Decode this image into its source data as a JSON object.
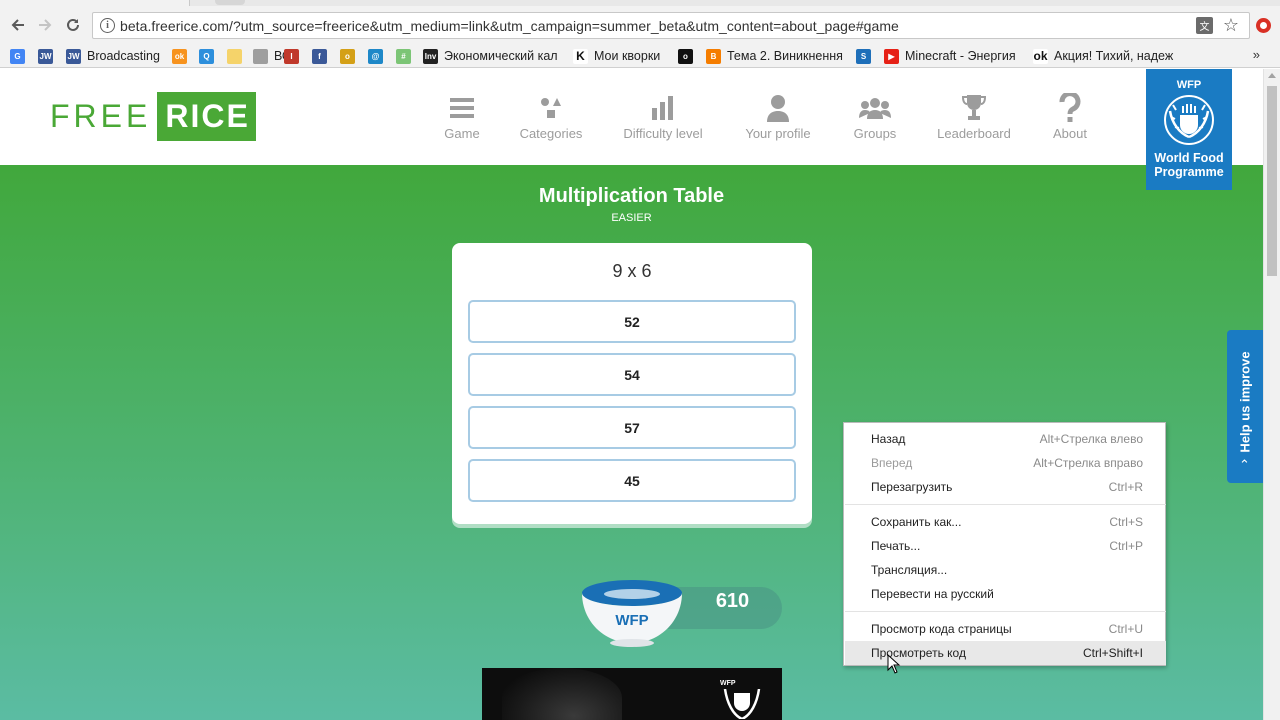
{
  "browser": {
    "url": "beta.freerice.com/?utm_source=freerice&utm_medium=link&utm_campaign=summer_beta&utm_content=about_page#game",
    "bookmarks": [
      {
        "label": "",
        "icon": "google-icon",
        "color": "#4285f4",
        "glyph": "G"
      },
      {
        "label": "",
        "icon": "jw-icon",
        "color": "#3a5998",
        "glyph": "JW"
      },
      {
        "label": "Broadcasting",
        "icon": "jw-icon",
        "color": "#3a5998",
        "glyph": "JW"
      },
      {
        "label": "",
        "icon": "odnoklassniki-icon",
        "color": "#f7931e",
        "glyph": "ok"
      },
      {
        "label": "",
        "icon": "search-icon",
        "color": "#2d8fdc",
        "glyph": "Q"
      },
      {
        "label": "",
        "icon": "folder-icon",
        "color": "#f5d36a",
        "glyph": ""
      },
      {
        "label": "ВСЁ",
        "icon": "page-icon",
        "color": "#9e9e9e",
        "glyph": ""
      },
      {
        "label": "",
        "icon": "thermometer-icon",
        "color": "#c0392b",
        "glyph": "I"
      },
      {
        "label": "",
        "icon": "facebook-icon",
        "color": "#3b5998",
        "glyph": "f"
      },
      {
        "label": "",
        "icon": "coin-icon",
        "color": "#d4a017",
        "glyph": "o"
      },
      {
        "label": "",
        "icon": "target-icon",
        "color": "#1e88c8",
        "glyph": "@"
      },
      {
        "label": "",
        "icon": "grid-icon",
        "color": "#7cc576",
        "glyph": "#"
      },
      {
        "label": "Экономический кал",
        "icon": "investing-icon",
        "color": "#222222",
        "glyph": "Inv"
      },
      {
        "label": "Мои кворки",
        "icon": "kwork-icon",
        "color": "#ffffff",
        "glyph": "K"
      },
      {
        "label": "",
        "icon": "circle-icon",
        "color": "#111111",
        "glyph": "o"
      },
      {
        "label": "Тема 2. Виникнення",
        "icon": "blogger-icon",
        "color": "#f57d00",
        "glyph": "B"
      },
      {
        "label": "",
        "icon": "box-icon",
        "color": "#1e6fb9",
        "glyph": "S"
      },
      {
        "label": "Minecraft - Энергия",
        "icon": "youtube-icon",
        "color": "#e62117",
        "glyph": "▶"
      },
      {
        "label": "Акция! Тихий, надеж",
        "icon": "ok-icon",
        "color": "#ffffff",
        "glyph": "ok"
      }
    ],
    "more": "»"
  },
  "site": {
    "logo_free": "FREE",
    "logo_rice": "RICE",
    "nav": [
      {
        "label": "Game",
        "icon": "menu-icon"
      },
      {
        "label": "Categories",
        "icon": "shapes-icon"
      },
      {
        "label": "Difficulty level",
        "icon": "bar-chart-icon"
      },
      {
        "label": "Your profile",
        "icon": "user-icon"
      },
      {
        "label": "Groups",
        "icon": "group-icon"
      },
      {
        "label": "Leaderboard",
        "icon": "trophy-icon"
      },
      {
        "label": "About",
        "icon": "question-icon"
      }
    ],
    "wfp_short": "WFP",
    "wfp_name": "World Food Programme"
  },
  "game": {
    "category": "Multiplication Table",
    "difficulty": "EASIER",
    "question": "9 x 6",
    "answers": [
      "52",
      "54",
      "57",
      "45"
    ],
    "rice_count": "610",
    "bowl_label": "WFP",
    "video_label": "WFP"
  },
  "help_tab": {
    "label": "Help us improve",
    "chevron": "‹"
  },
  "context_menu": {
    "items": [
      {
        "label": "Назад",
        "shortcut": "Alt+Стрелка влево",
        "enabled": true
      },
      {
        "label": "Вперед",
        "shortcut": "Alt+Стрелка вправо",
        "enabled": false
      },
      {
        "label": "Перезагрузить",
        "shortcut": "Ctrl+R",
        "enabled": true
      },
      {
        "label": "Сохранить как...",
        "shortcut": "Ctrl+S",
        "enabled": true
      },
      {
        "label": "Печать...",
        "shortcut": "Ctrl+P",
        "enabled": true
      },
      {
        "label": "Трансляция...",
        "shortcut": "",
        "enabled": true
      },
      {
        "label": "Перевести на русский",
        "shortcut": "",
        "enabled": true
      },
      {
        "label": "Просмотр кода страницы",
        "shortcut": "Ctrl+U",
        "enabled": true
      },
      {
        "label": "Просмотреть код",
        "shortcut": "Ctrl+Shift+I",
        "enabled": true,
        "hovered": true
      }
    ]
  },
  "colors": {
    "brand_green": "#4aa836",
    "wfp_blue": "#1a7bc3",
    "answer_border": "#a7cbe4"
  }
}
